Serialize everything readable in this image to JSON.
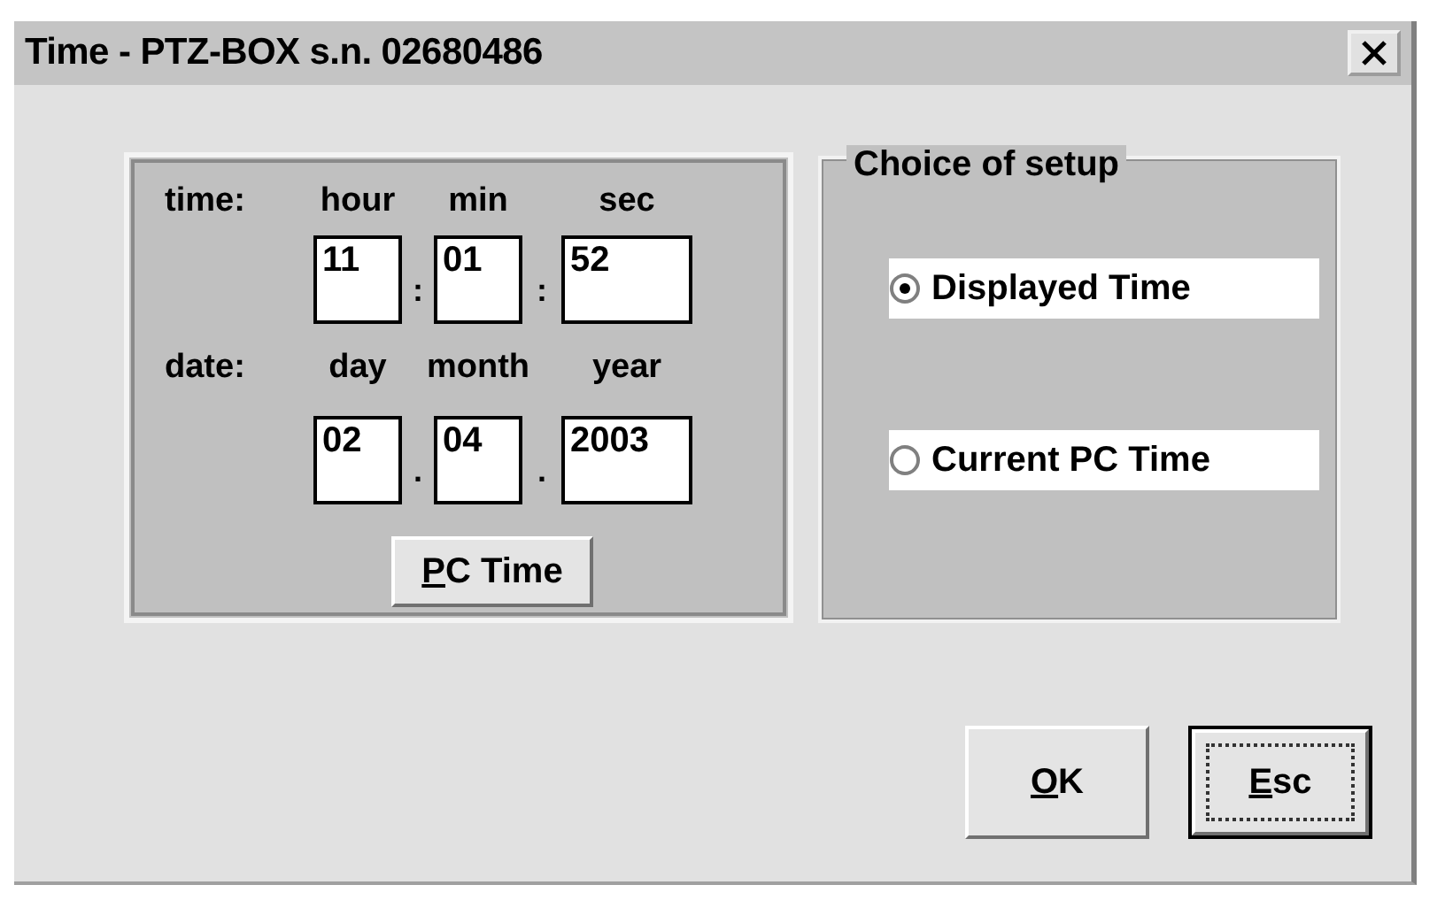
{
  "window": {
    "title": "Time - PTZ-BOX s.n. 02680486"
  },
  "clock": {
    "rows": [
      {
        "label": "time:",
        "separator": ":",
        "fields": [
          {
            "caption": "hour",
            "value": "11"
          },
          {
            "caption": "min",
            "value": "01"
          },
          {
            "caption": "sec",
            "value": "52"
          }
        ]
      },
      {
        "label": "date:",
        "separator": ".",
        "fields": [
          {
            "caption": "day",
            "value": "02"
          },
          {
            "caption": "month",
            "value": "04"
          },
          {
            "caption": "year",
            "value": "2003"
          }
        ]
      }
    ],
    "button": {
      "label": "PC Time"
    }
  },
  "setup": {
    "title": "Choice of setup",
    "options": [
      {
        "label": "Displayed Time",
        "selected": true
      },
      {
        "label": "Current PC Time",
        "selected": false
      }
    ]
  },
  "buttons": [
    {
      "label": "OK",
      "focused": false
    },
    {
      "label": "Esc",
      "focused": true
    }
  ]
}
